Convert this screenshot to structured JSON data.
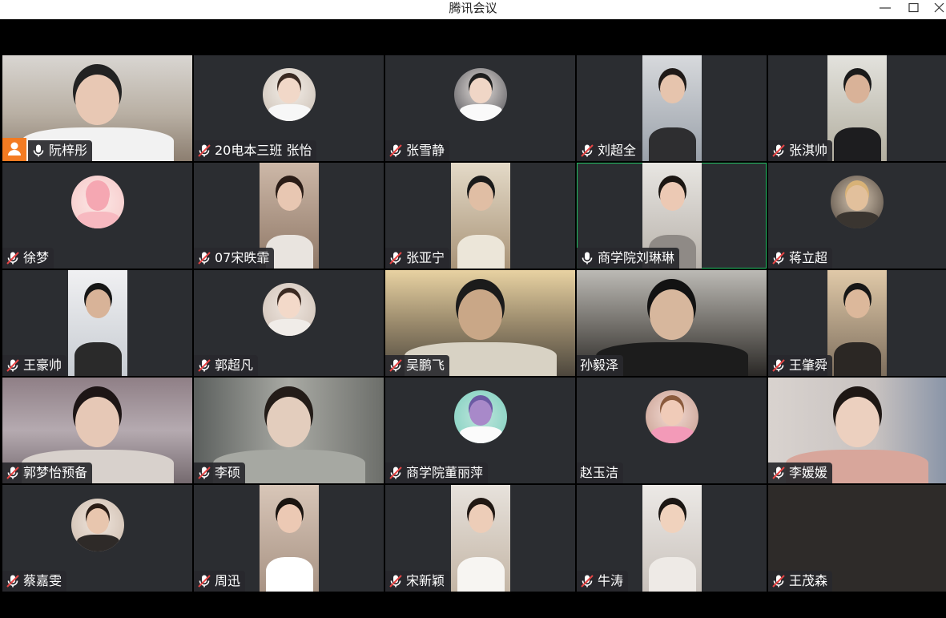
{
  "window": {
    "title": "腾讯会议",
    "minimize_icon": "minimize-icon",
    "maximize_icon": "maximize-icon",
    "close_icon": "close-icon"
  },
  "colors": {
    "tile_bg": "#2b2d31",
    "label_bg": "#28282c",
    "host_badge": "#f37b22",
    "active_speaker_border": "#22c064",
    "mic_muted": "#e64545"
  },
  "participants": [
    {
      "name": "阮梓彤",
      "mic": "on",
      "host": true,
      "view": "video"
    },
    {
      "name": "20电本三班 张怡",
      "mic": "muted",
      "view": "avatar"
    },
    {
      "name": "张雪静",
      "mic": "muted",
      "view": "avatar"
    },
    {
      "name": "刘超全",
      "mic": "muted",
      "view": "portrait"
    },
    {
      "name": "张淇帅",
      "mic": "muted",
      "view": "portrait"
    },
    {
      "name": "徐梦",
      "mic": "muted",
      "view": "avatar"
    },
    {
      "name": "07宋昳霏",
      "mic": "muted",
      "view": "portrait"
    },
    {
      "name": "张亚宁",
      "mic": "muted",
      "view": "portrait"
    },
    {
      "name": "商学院刘琳琳",
      "mic": "on",
      "active": true,
      "view": "portrait"
    },
    {
      "name": "蒋立超",
      "mic": "muted",
      "view": "avatar"
    },
    {
      "name": "王豪帅",
      "mic": "muted",
      "view": "portrait"
    },
    {
      "name": "郭超凡",
      "mic": "muted",
      "view": "avatar"
    },
    {
      "name": "吴鹏飞",
      "mic": "muted",
      "view": "video"
    },
    {
      "name": "孙毅泽",
      "mic": "none",
      "view": "video"
    },
    {
      "name": "王肇舜",
      "mic": "muted",
      "view": "portrait"
    },
    {
      "name": "郭梦怡预备",
      "mic": "muted",
      "view": "video"
    },
    {
      "name": "李硕",
      "mic": "muted",
      "view": "video"
    },
    {
      "name": "商学院董丽萍",
      "mic": "muted",
      "view": "avatar"
    },
    {
      "name": "赵玉洁",
      "mic": "none",
      "view": "avatar"
    },
    {
      "name": "李媛媛",
      "mic": "muted",
      "view": "video"
    },
    {
      "name": "蔡嘉雯",
      "mic": "muted",
      "view": "avatar"
    },
    {
      "name": "周迅",
      "mic": "muted",
      "view": "portrait"
    },
    {
      "name": "宋新颖",
      "mic": "muted",
      "view": "portrait"
    },
    {
      "name": "牛涛",
      "mic": "muted",
      "view": "portrait"
    },
    {
      "name": "王茂森",
      "mic": "muted",
      "view": "empty"
    }
  ]
}
